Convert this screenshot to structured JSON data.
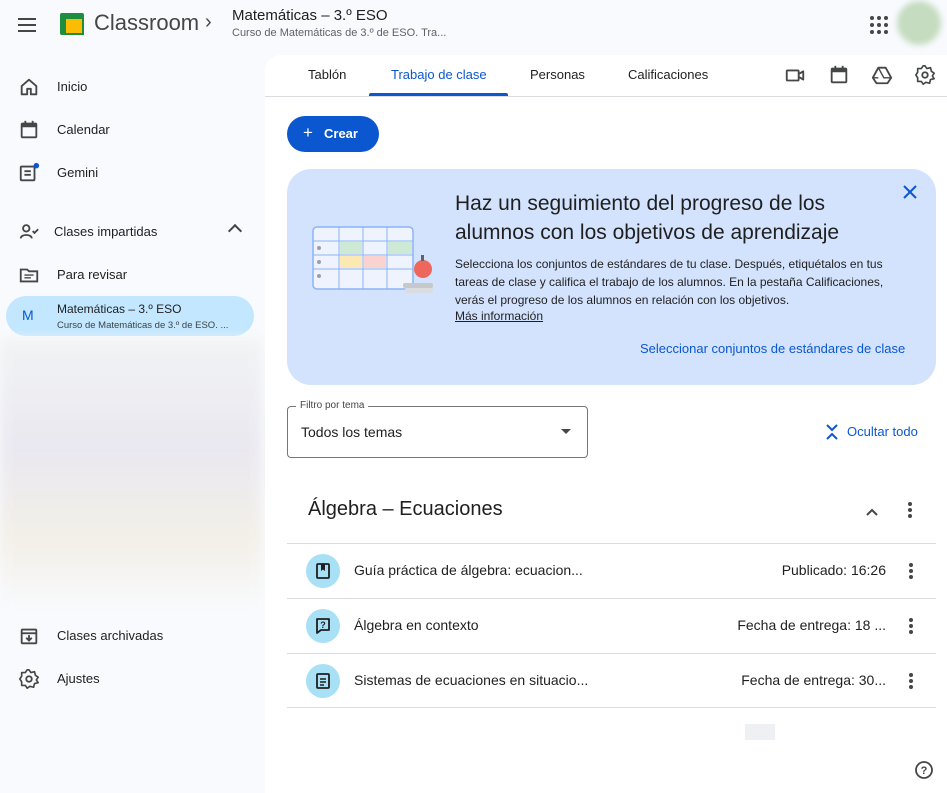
{
  "header": {
    "app_title": "Classroom",
    "class_title": "Matemáticas – 3.º ESO",
    "class_subtitle": "Curso de Matemáticas de 3.º de ESO. Tra..."
  },
  "sidebar": {
    "items": [
      {
        "label": "Inicio",
        "icon": "home-icon"
      },
      {
        "label": "Calendar",
        "icon": "calendar-icon"
      },
      {
        "label": "Gemini",
        "icon": "gemini-icon"
      }
    ],
    "teaching_section": "Clases impartidas",
    "to_review": "Para revisar",
    "active_class": {
      "initial": "M",
      "title": "Matemáticas – 3.º ESO",
      "subtitle": "Curso de Matemáticas de 3.º de ESO. ..."
    },
    "archived": "Clases archivadas",
    "settings": "Ajustes"
  },
  "tabs": [
    {
      "label": "Tablón"
    },
    {
      "label": "Trabajo de clase"
    },
    {
      "label": "Personas"
    },
    {
      "label": "Calificaciones"
    }
  ],
  "active_tab": "Trabajo de clase",
  "create_button": {
    "icon": "+",
    "label": "Crear"
  },
  "banner": {
    "heading": "Haz un seguimiento del progreso de los alumnos con los objetivos de aprendizaje",
    "body": "Selecciona los conjuntos de estándares de tu clase. Después, etiquétalos en tus tareas de clase y califica el trabajo de los alumnos. En la pestaña Calificaciones, verás el progreso de los alumnos en relación con los objetivos.",
    "link": "Más información",
    "action": "Seleccionar conjuntos de estándares de clase"
  },
  "filter": {
    "label": "Filtro por tema",
    "value": "Todos los temas"
  },
  "hide_all": "Ocultar todo",
  "topic": {
    "title": "Álgebra – Ecuaciones",
    "items": [
      {
        "title": "Guía práctica de álgebra: ecuacion...",
        "meta": "Publicado: 16:26",
        "icon": "material-icon"
      },
      {
        "title": "Álgebra en contexto",
        "meta": "Fecha de entrega: 18 ...",
        "icon": "question-icon"
      },
      {
        "title": "Sistemas de ecuaciones en situacio...",
        "meta": "Fecha de entrega: 30...",
        "icon": "assignment-icon"
      }
    ]
  },
  "colors": {
    "accent": "#0b57d0",
    "active_bg": "#c2e7ff",
    "banner_bg": "#d3e3fd",
    "item_icon_bg": "#a8e0f5"
  }
}
